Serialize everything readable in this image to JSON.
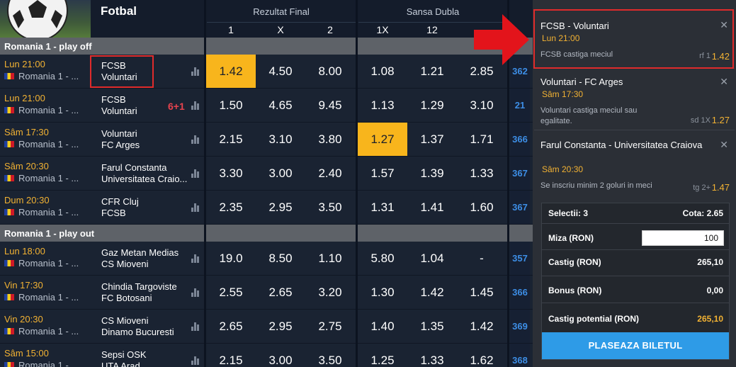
{
  "header": {
    "sport": "Fotbal",
    "group_final": "Rezultat Final",
    "group_double": "Sansa Dubla",
    "cols": [
      "1",
      "X",
      "2",
      "1X",
      "12"
    ]
  },
  "sections": [
    {
      "title": "Romania 1 - play off",
      "rows": [
        {
          "time": "Lun 21:00",
          "league": "Romania 1 - ...",
          "home": "FCSB",
          "away": "Voluntari",
          "extra": "",
          "odds": [
            "1.42",
            "4.50",
            "8.00",
            "1.08",
            "1.21",
            "2.85"
          ],
          "more": "362",
          "selected": 0
        },
        {
          "time": "Lun 21:00",
          "league": "Romania 1 - ...",
          "home": "FCSB",
          "away": "Voluntari",
          "extra": "6+1",
          "odds": [
            "1.50",
            "4.65",
            "9.45",
            "1.13",
            "1.29",
            "3.10"
          ],
          "more": "21",
          "selected": -1
        },
        {
          "time": "Sâm 17:30",
          "league": "Romania 1 - ...",
          "home": "Voluntari",
          "away": "FC Arges",
          "extra": "",
          "odds": [
            "2.15",
            "3.10",
            "3.80",
            "1.27",
            "1.37",
            "1.71"
          ],
          "more": "366",
          "selected": 3
        },
        {
          "time": "Sâm 20:30",
          "league": "Romania 1 - ...",
          "home": "Farul Constanta",
          "away": "Universitatea Craio...",
          "extra": "",
          "odds": [
            "3.30",
            "3.00",
            "2.40",
            "1.57",
            "1.39",
            "1.33"
          ],
          "more": "367",
          "selected": -1
        },
        {
          "time": "Dum 20:30",
          "league": "Romania 1 - ...",
          "home": "CFR Cluj",
          "away": "FCSB",
          "extra": "",
          "odds": [
            "2.35",
            "2.95",
            "3.50",
            "1.31",
            "1.41",
            "1.60"
          ],
          "more": "367",
          "selected": -1
        }
      ]
    },
    {
      "title": "Romania 1 - play out",
      "rows": [
        {
          "time": "Lun 18:00",
          "league": "Romania 1 - ...",
          "home": "Gaz Metan Medias",
          "away": "CS Mioveni",
          "extra": "",
          "odds": [
            "19.0",
            "8.50",
            "1.10",
            "5.80",
            "1.04",
            "-"
          ],
          "more": "357",
          "selected": -1
        },
        {
          "time": "Vin 17:30",
          "league": "Romania 1 - ...",
          "home": "Chindia Targoviste",
          "away": "FC Botosani",
          "extra": "",
          "odds": [
            "2.55",
            "2.65",
            "3.20",
            "1.30",
            "1.42",
            "1.45"
          ],
          "more": "366",
          "selected": -1
        },
        {
          "time": "Vin 20:30",
          "league": "Romania 1 - ...",
          "home": "CS Mioveni",
          "away": "Dinamo Bucuresti",
          "extra": "",
          "odds": [
            "2.65",
            "2.95",
            "2.75",
            "1.40",
            "1.35",
            "1.42"
          ],
          "more": "369",
          "selected": -1
        },
        {
          "time": "Sâm 15:00",
          "league": "Romania 1 - ...",
          "home": "Sepsi OSK",
          "away": "UTA Arad",
          "extra": "",
          "odds": [
            "2.15",
            "3.00",
            "3.50",
            "1.25",
            "1.33",
            "1.62"
          ],
          "more": "368",
          "selected": -1
        }
      ]
    }
  ],
  "betslip": {
    "bets": [
      {
        "match": "FCSB - Voluntari",
        "time": "Lun 21:00",
        "pick": "FCSB castiga meciul",
        "market": "rf 1",
        "odd": "1.42"
      },
      {
        "match": "Voluntari - FC Arges",
        "time": "Sâm 17:30",
        "pick": "Voluntari castiga meciul sau egalitate.",
        "market": "sd 1X",
        "odd": "1.27"
      },
      {
        "match": "Farul Constanta - Universitatea Craiova",
        "time": "Sâm 20:30",
        "pick": "Se inscriu minim 2 goluri in meci",
        "market": "tg 2+",
        "odd": "1.47"
      }
    ],
    "close_glyph": "✕",
    "selections_label": "Selectii: 3",
    "odds_label": "Cota: 2.65",
    "stake_label": "Miza (RON)",
    "stake_value": "100",
    "win_label": "Castig (RON)",
    "win_value": "265,10",
    "bonus_label": "Bonus (RON)",
    "bonus_value": "0,00",
    "potential_label": "Castig potential (RON)",
    "potential_value": "265,10",
    "place_button": "PLASEAZA BILETUL"
  },
  "colors": {
    "accent_yellow": "#f8b51c",
    "link_blue": "#3d8ee6",
    "button_blue": "#2e9be7",
    "highlight_red": "#e02b2b"
  }
}
